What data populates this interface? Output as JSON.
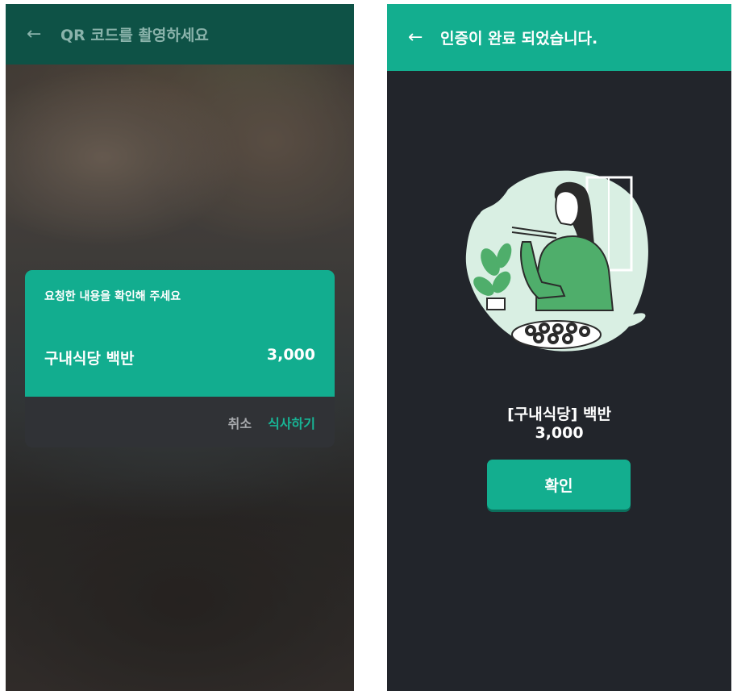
{
  "qr_screen": {
    "back_icon": "arrow-left-icon",
    "title": "QR 코드를 촬영하세요",
    "dialog": {
      "message": "요청한 내용을 확인해 주세요",
      "item_name": "구내식당 백반",
      "price": "3,000",
      "cancel_label": "취소",
      "confirm_label": "식사하기"
    }
  },
  "done_screen": {
    "back_icon": "arrow-left-icon",
    "title": "인증이 완료 되었습니다.",
    "item_name": "[구내식당] 백반",
    "price": "3,000",
    "confirm_label": "확인"
  },
  "colors": {
    "accent": "#13ae8f",
    "dark_appbar": "#0e5246",
    "dark_bg": "#22252b",
    "dialog_footer": "#303236"
  }
}
